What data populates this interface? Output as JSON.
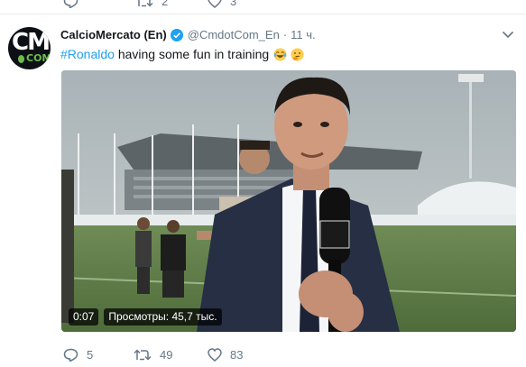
{
  "previous_tweet": {
    "actions": [
      {
        "icon": "reply-icon",
        "count": ""
      },
      {
        "icon": "retweet-icon",
        "count": "2"
      },
      {
        "icon": "like-icon",
        "count": "3"
      }
    ]
  },
  "tweet": {
    "author_name": "CalcioMercato (En)",
    "author_handle": "@CmdotCom_En",
    "separator": "·",
    "timestamp": "11 ч.",
    "verified_icon": "verified-badge-icon",
    "avatar": {
      "line1": "CM",
      "line2": "COM"
    },
    "text": {
      "hashtag": "#Ronaldo",
      "body": " having some fun in training"
    },
    "emojis": [
      "face-with-tears-of-joy",
      "thinking-face"
    ],
    "video": {
      "duration": "0:07",
      "views": "Просмотры: 45,7 тыс."
    },
    "actions": {
      "replies": "5",
      "retweets": "49",
      "likes": "83"
    }
  },
  "colors": {
    "link": "#1da1f2",
    "secondary_text": "#657786",
    "verified": "#1da1f2",
    "divider": "#e6ecf0"
  }
}
